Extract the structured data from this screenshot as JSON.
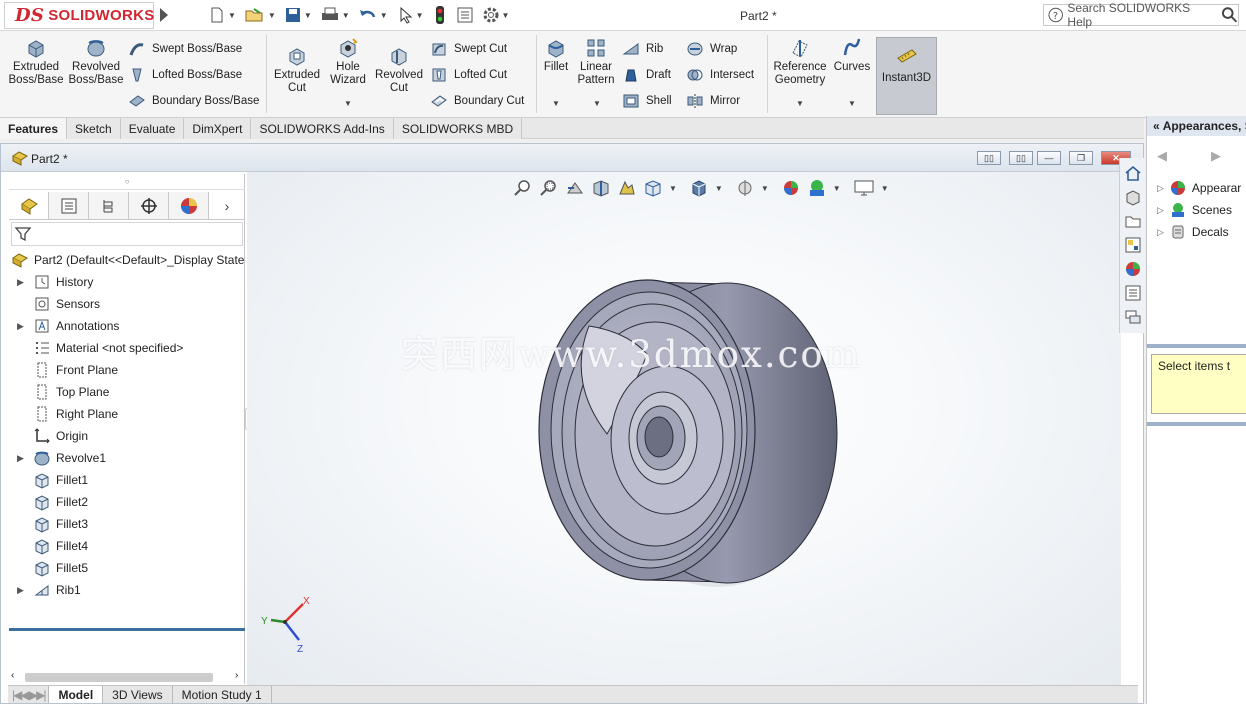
{
  "app": {
    "brand": "SOLIDWORKS",
    "document_title": "Part2 *",
    "help_placeholder": "Search SOLIDWORKS Help"
  },
  "ribbon": {
    "extruded_boss": "Extruded Boss/Base",
    "revolved_boss": "Revolved Boss/Base",
    "swept_boss": "Swept Boss/Base",
    "lofted_boss": "Lofted Boss/Base",
    "boundary_boss": "Boundary Boss/Base",
    "extruded_cut": "Extruded Cut",
    "hole_wizard": "Hole Wizard",
    "revolved_cut": "Revolved Cut",
    "swept_cut": "Swept Cut",
    "lofted_cut": "Lofted Cut",
    "boundary_cut": "Boundary Cut",
    "fillet": "Fillet",
    "linear_pattern": "Linear Pattern",
    "rib": "Rib",
    "draft": "Draft",
    "shell": "Shell",
    "wrap": "Wrap",
    "intersect": "Intersect",
    "mirror": "Mirror",
    "reference_geometry": "Reference Geometry",
    "curves": "Curves",
    "instant3d": "Instant3D"
  },
  "command_tabs": [
    "Features",
    "Sketch",
    "Evaluate",
    "DimXpert",
    "SOLIDWORKS Add-Ins",
    "SOLIDWORKS MBD"
  ],
  "document": {
    "window_title": "Part2 *"
  },
  "feature_tree": {
    "root": "Part2  (Default<<Default>_Display State",
    "items": [
      {
        "label": "History",
        "expandable": true,
        "icon": "history-icon"
      },
      {
        "label": "Sensors",
        "expandable": false,
        "icon": "sensors-icon"
      },
      {
        "label": "Annotations",
        "expandable": true,
        "icon": "annotations-icon"
      },
      {
        "label": "Material <not specified>",
        "expandable": false,
        "icon": "material-icon"
      },
      {
        "label": "Front Plane",
        "expandable": false,
        "icon": "plane-icon"
      },
      {
        "label": "Top Plane",
        "expandable": false,
        "icon": "plane-icon"
      },
      {
        "label": "Right Plane",
        "expandable": false,
        "icon": "plane-icon"
      },
      {
        "label": "Origin",
        "expandable": false,
        "icon": "origin-icon"
      },
      {
        "label": "Revolve1",
        "expandable": true,
        "icon": "revolve-icon"
      },
      {
        "label": "Fillet1",
        "expandable": false,
        "icon": "fillet-icon"
      },
      {
        "label": "Fillet2",
        "expandable": false,
        "icon": "fillet-icon"
      },
      {
        "label": "Fillet3",
        "expandable": false,
        "icon": "fillet-icon"
      },
      {
        "label": "Fillet4",
        "expandable": false,
        "icon": "fillet-icon"
      },
      {
        "label": "Fillet5",
        "expandable": false,
        "icon": "fillet-icon"
      },
      {
        "label": "Rib1",
        "expandable": true,
        "icon": "rib-icon"
      }
    ]
  },
  "viewport": {
    "watermark": "突西网www.3dmox.com",
    "triad": {
      "x": "X",
      "y": "Y",
      "z": "Z"
    }
  },
  "task_pane": {
    "header": "Appearances, S",
    "items": [
      "Appearar",
      "Scenes",
      "Decals"
    ],
    "note": "Select items t"
  },
  "bottom_tabs": [
    "Model",
    "3D Views",
    "Motion Study 1"
  ],
  "colors": {
    "accent": "#d22630",
    "model": "#8d8fa6",
    "selection_blue": "#3b6fa0"
  }
}
